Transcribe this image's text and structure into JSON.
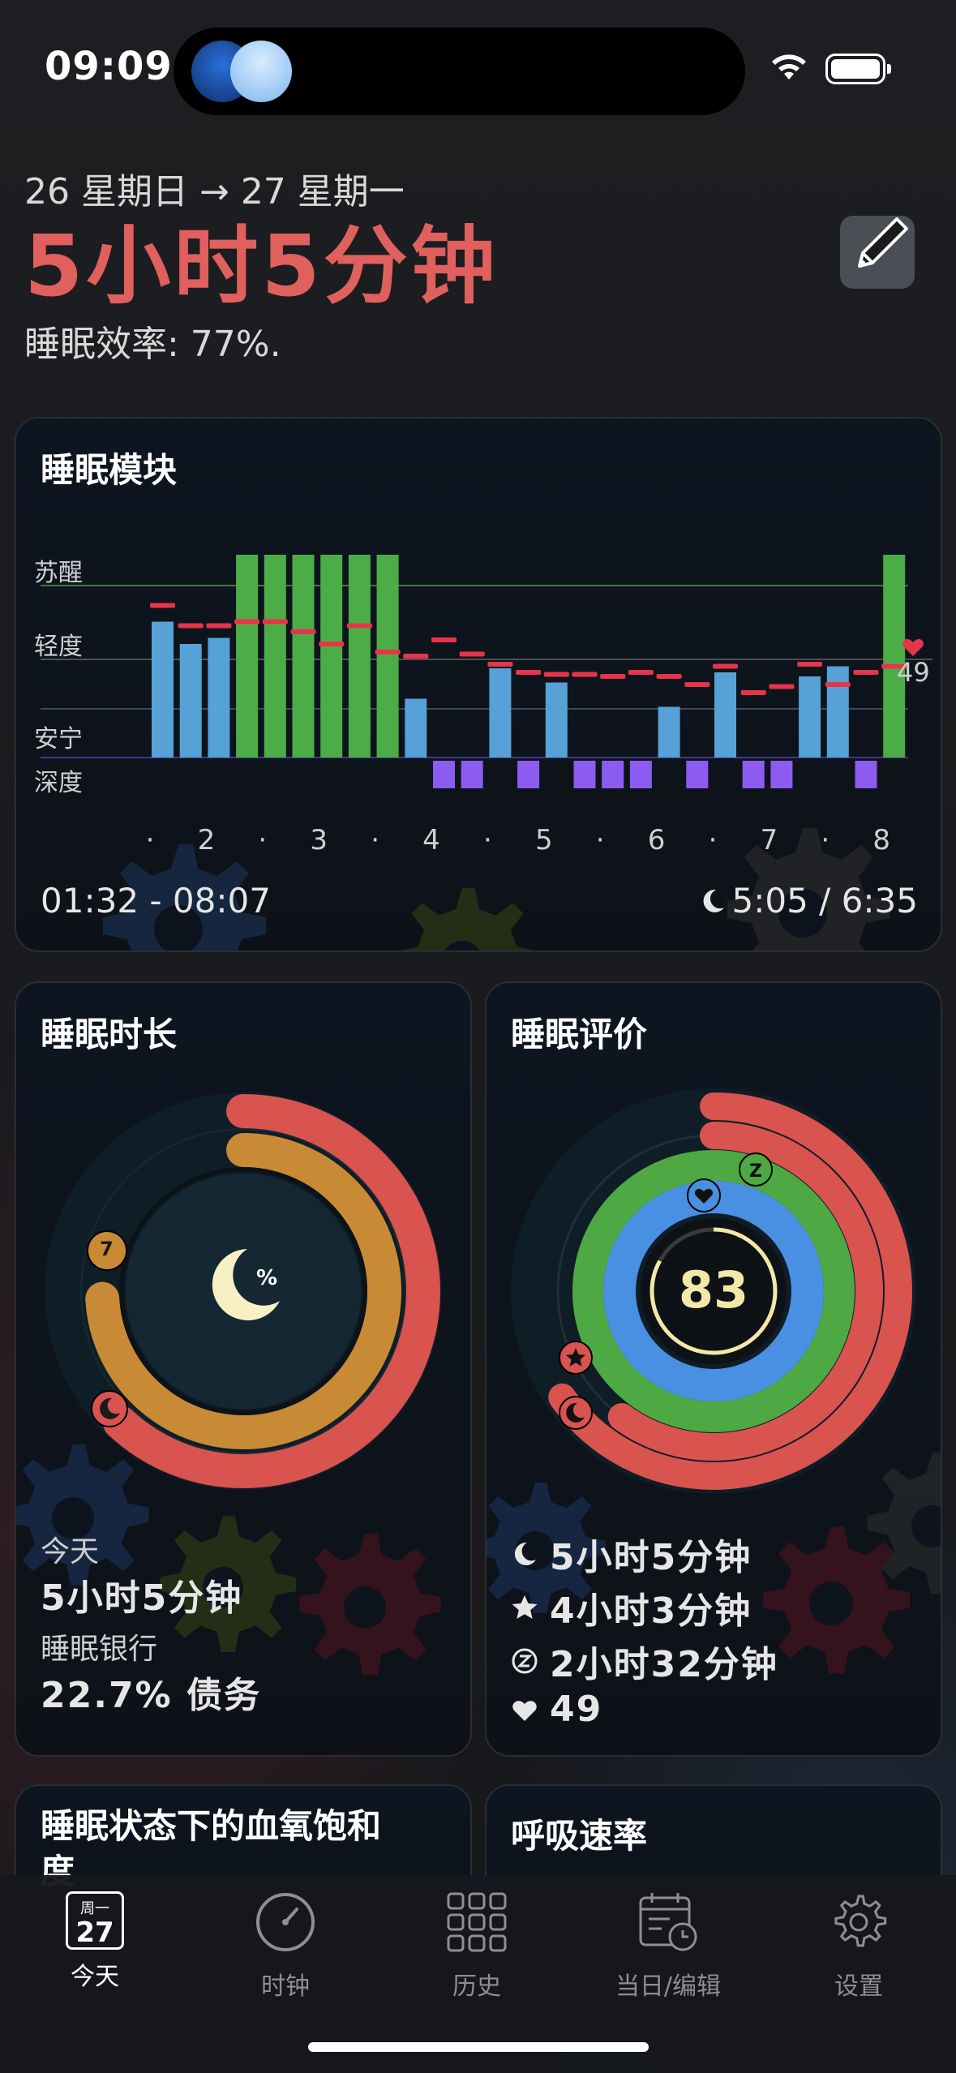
{
  "status_bar": {
    "time": "09:09"
  },
  "header": {
    "dates": "26 星期日 → 27 星期一",
    "duration": "5小时5分钟",
    "efficiency": "睡眠效率: 77%.",
    "edit_icon": "pencil-icon"
  },
  "sleep_module": {
    "title": "睡眠模块",
    "stage_labels": [
      "苏醒",
      "轻度",
      "安宁",
      "深度"
    ],
    "x_ticks": [
      "·",
      "2",
      "·",
      "3",
      "·",
      "4",
      "·",
      "5",
      "·",
      "6",
      "·",
      "7",
      "·",
      "8"
    ],
    "heart_value": "49",
    "time_range": "01:32 - 08:07",
    "sleep_ratio": "5:05 / 6:35"
  },
  "chart_data": {
    "type": "bar",
    "title": "睡眠模块",
    "xlabel": "",
    "ylabel": "",
    "x_ticks": [
      "·",
      "2",
      "·",
      "3",
      "·",
      "4",
      "·",
      "5",
      "·",
      "6",
      "·",
      "7",
      "·",
      "8"
    ],
    "y_categories": [
      "深度",
      "安宁",
      "轻度",
      "苏醒"
    ],
    "columns": [
      {
        "stage": "轻度",
        "level": 0.67,
        "hr": 0.75
      },
      {
        "stage": "轻度",
        "level": 0.56,
        "hr": 0.65
      },
      {
        "stage": "轻度",
        "level": 0.59,
        "hr": 0.65
      },
      {
        "stage": "苏醒",
        "level": 1.0,
        "hr": 0.67
      },
      {
        "stage": "苏醒",
        "level": 1.0,
        "hr": 0.67
      },
      {
        "stage": "苏醒",
        "level": 1.0,
        "hr": 0.62
      },
      {
        "stage": "苏醒",
        "level": 1.0,
        "hr": 0.56
      },
      {
        "stage": "苏醒",
        "level": 1.0,
        "hr": 0.65
      },
      {
        "stage": "苏醒",
        "level": 1.0,
        "hr": 0.52
      },
      {
        "stage": "安宁",
        "level": 0.29,
        "hr": 0.5
      },
      {
        "stage": "深度",
        "level": 0.0,
        "hr": 0.58
      },
      {
        "stage": "深度",
        "level": 0.0,
        "hr": 0.51
      },
      {
        "stage": "轻度",
        "level": 0.44,
        "hr": 0.46
      },
      {
        "stage": "深度",
        "level": 0.0,
        "hr": 0.42
      },
      {
        "stage": "轻度",
        "level": 0.37,
        "hr": 0.41
      },
      {
        "stage": "深度",
        "level": 0.0,
        "hr": 0.41
      },
      {
        "stage": "深度",
        "level": 0.0,
        "hr": 0.4
      },
      {
        "stage": "深度",
        "level": 0.0,
        "hr": 0.42
      },
      {
        "stage": "安宁",
        "level": 0.25,
        "hr": 0.4
      },
      {
        "stage": "深度",
        "level": 0.0,
        "hr": 0.36
      },
      {
        "stage": "轻度",
        "level": 0.42,
        "hr": 0.45
      },
      {
        "stage": "深度",
        "level": 0.0,
        "hr": 0.32
      },
      {
        "stage": "深度",
        "level": 0.0,
        "hr": 0.35
      },
      {
        "stage": "轻度",
        "level": 0.4,
        "hr": 0.46
      },
      {
        "stage": "轻度",
        "level": 0.45,
        "hr": 0.36
      },
      {
        "stage": "深度",
        "level": 0.0,
        "hr": 0.42
      },
      {
        "stage": "苏醒",
        "level": 1.0,
        "hr": 0.45
      }
    ],
    "heart_rate_label": "49",
    "colors": {
      "苏醒": "#4cad46",
      "轻度": "#56a1d5",
      "安宁": "#56a1d5",
      "深度": "#8c5cf0",
      "hr": "#e8344a"
    }
  },
  "sleep_duration": {
    "title": "睡眠时长",
    "today_label": "今天",
    "today_value": "5小时5分钟",
    "bank_label": "睡眠银行",
    "bank_value": "22.7% 债务",
    "badge_number": "7",
    "rings": [
      {
        "name": "outer",
        "color": "#d9534f",
        "fraction": 0.62
      },
      {
        "name": "inner",
        "color": "#c98a35",
        "fraction": 0.74
      }
    ]
  },
  "sleep_rating": {
    "title": "睡眠评价",
    "score": "83",
    "rings": [
      {
        "color": "#d9534f",
        "fraction": 0.65
      },
      {
        "color": "#d9534f",
        "fraction": 0.6
      },
      {
        "color": "#4ea843",
        "fraction": 1.0
      },
      {
        "color": "#4a90e2",
        "fraction": 1.0
      }
    ],
    "items": [
      {
        "icon": "moon-icon",
        "text": "5小时5分钟"
      },
      {
        "icon": "star-icon",
        "text": "4小时3分钟"
      },
      {
        "icon": "zzz-icon",
        "text": "2小时32分钟"
      },
      {
        "icon": "heart-icon",
        "text": "49"
      }
    ]
  },
  "blood_oxygen": {
    "title": "睡眠状态下的血氧饱和度"
  },
  "respiration": {
    "title": "呼吸速率"
  },
  "tab_bar": {
    "calendar_weekday": "周一",
    "calendar_day": "27",
    "tabs": [
      {
        "label": "今天",
        "icon": "calendar-icon"
      },
      {
        "label": "时钟",
        "icon": "clock-icon"
      },
      {
        "label": "历史",
        "icon": "grid-icon"
      },
      {
        "label": "当日/编辑",
        "icon": "calendar-edit-icon"
      },
      {
        "label": "设置",
        "icon": "gear-icon"
      }
    ]
  }
}
